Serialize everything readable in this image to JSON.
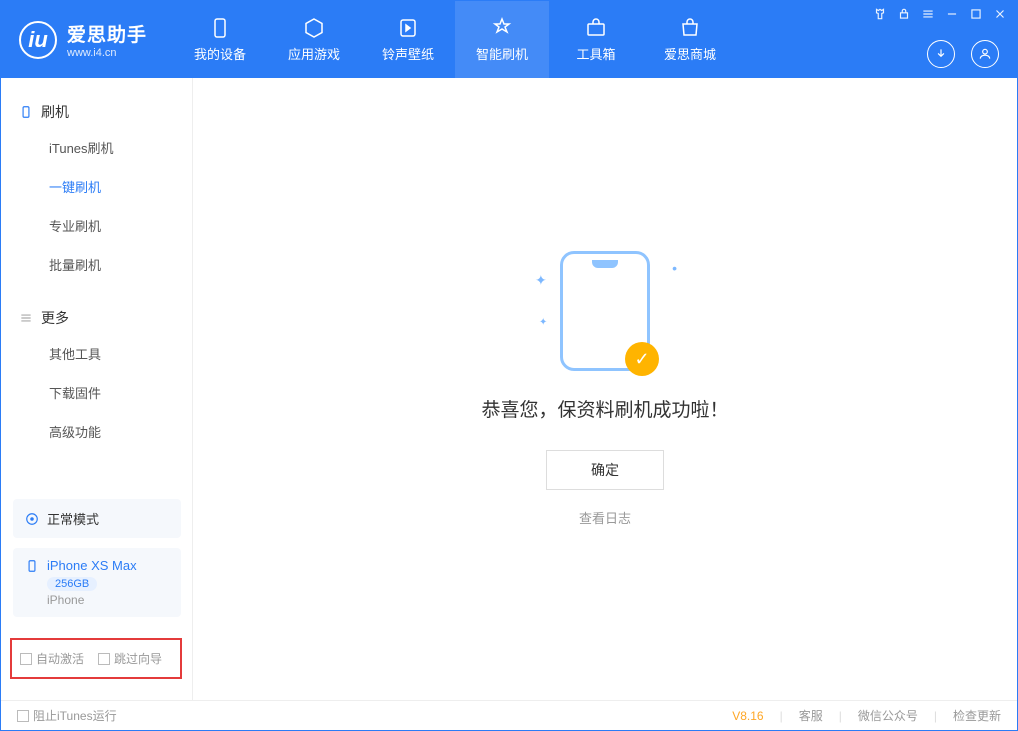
{
  "app": {
    "name": "爱思助手",
    "url": "www.i4.cn"
  },
  "nav": {
    "device": "我的设备",
    "apps": "应用游戏",
    "ringtone": "铃声壁纸",
    "flash": "智能刷机",
    "toolbox": "工具箱",
    "store": "爱思商城"
  },
  "sidebar": {
    "section1": {
      "title": "刷机",
      "items": [
        "iTunes刷机",
        "一键刷机",
        "专业刷机",
        "批量刷机"
      ]
    },
    "section2": {
      "title": "更多",
      "items": [
        "其他工具",
        "下载固件",
        "高级功能"
      ]
    }
  },
  "deviceMode": "正常模式",
  "device": {
    "name": "iPhone XS Max",
    "storage": "256GB",
    "type": "iPhone"
  },
  "options": {
    "autoActivate": "自动激活",
    "skipGuide": "跳过向导"
  },
  "main": {
    "successText": "恭喜您，保资料刷机成功啦！",
    "okButton": "确定",
    "logLink": "查看日志"
  },
  "footer": {
    "blockItunes": "阻止iTunes运行",
    "version": "V8.16",
    "support": "客服",
    "wechat": "微信公众号",
    "update": "检查更新"
  }
}
